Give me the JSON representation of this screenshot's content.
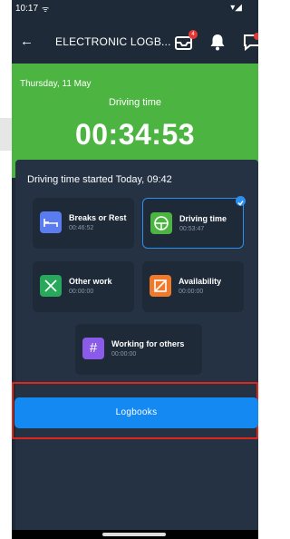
{
  "status_bar": {
    "time": "10:17",
    "carrier_icon": "signal-icon"
  },
  "app_bar": {
    "title": "ELECTRONIC LOGB...",
    "back_icon": "back-arrow-icon",
    "notification_count": "4"
  },
  "header": {
    "date": "Thursday, 11 May",
    "current_activity": "Driving time",
    "timer": "00:34:53",
    "background": "#4cb541"
  },
  "panel": {
    "started_text": "Driving time started Today, 09:42",
    "activities": [
      {
        "name": "Breaks or Rest",
        "time": "00:46:52",
        "color": "#5b7bf0",
        "icon": "bed-icon",
        "selected": false
      },
      {
        "name": "Driving time",
        "time": "00:53:47",
        "color": "#4cb541",
        "icon": "steering-wheel-icon",
        "selected": true
      },
      {
        "name": "Other work",
        "time": "00:00:00",
        "color": "#27a85a",
        "icon": "tools-icon",
        "selected": false
      },
      {
        "name": "Availability",
        "time": "00:00:00",
        "color": "#f07a2b",
        "icon": "availability-icon",
        "selected": false
      },
      {
        "name": "Working for others",
        "time": "00:00:00",
        "color": "#8a5be8",
        "icon": "hash-icon",
        "selected": false
      }
    ]
  },
  "logbooks_button": {
    "label": "Logbooks",
    "color": "#1589f2"
  }
}
